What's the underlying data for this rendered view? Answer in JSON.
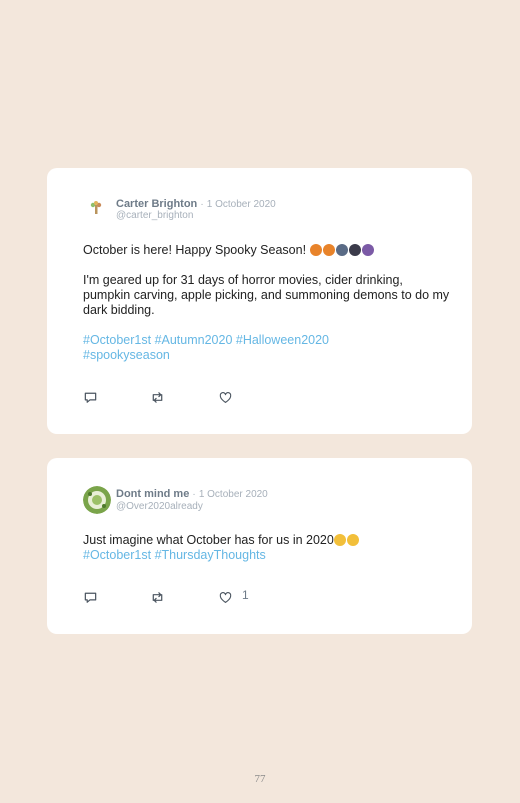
{
  "posts": [
    {
      "author": "Carter Brighton",
      "separator": "·",
      "date": "1 October 2020",
      "handle": "@carter_brighton",
      "line1": "October is here! Happy Spooky Season! ",
      "line1_emoji": [
        "jack-o-lantern",
        "jack-o-lantern",
        "ghost-person",
        "vampire",
        "witch"
      ],
      "paragraph2": "I'm geared up for 31 days of horror movies, cider drinking, pumpkin carving, apple picking, and summoning demons to do my dark bidding.",
      "hashtags_line1": "#October1st #Autumn2020 #Halloween2020",
      "hashtags_line2": "#spookyseason",
      "avatar_icon": "tree-icon"
    },
    {
      "author": "Dont mind me",
      "separator": "·",
      "date": "1 October 2020",
      "handle": "@Over2020already",
      "line1": "Just imagine what October has for us in 2020",
      "line1_emoji": [
        "unamused-face",
        "unamused-face"
      ],
      "hashtags_line1": "#October1st #ThursdayThoughts",
      "like_count": "1",
      "avatar_icon": "wreath-icon"
    }
  ],
  "page_number": "77",
  "colors": {
    "background": "#f3e7dc",
    "card": "#ffffff",
    "hashtag": "#65b7e4",
    "muted": "#a7b0ba",
    "name": "#6e7b88"
  }
}
